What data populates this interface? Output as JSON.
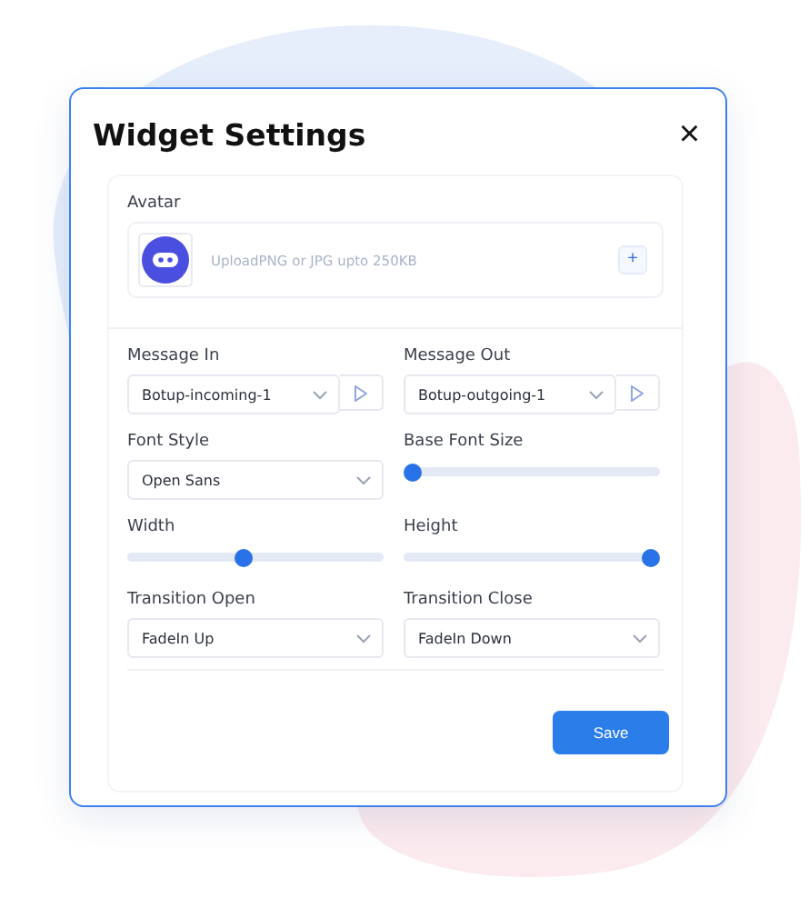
{
  "dialog": {
    "title": "Widget Settings",
    "close": "×"
  },
  "avatar": {
    "label": "Avatar",
    "hint": "UploadPNG or JPG upto 250KB",
    "add": "+"
  },
  "fields": [
    {
      "kind": "select-play",
      "label": "Message In",
      "value": "Botup-incoming-1"
    },
    {
      "kind": "select-play",
      "label": "Message Out",
      "value": "Botup-outgoing-1"
    },
    {
      "kind": "select",
      "label": "Font Style",
      "value": "Open Sans"
    },
    {
      "kind": "slider",
      "label": "Base Font Size",
      "level": 0
    },
    {
      "kind": "slider",
      "label": "Width",
      "level": 0.45
    },
    {
      "kind": "slider",
      "label": "Height",
      "level": 1
    },
    {
      "kind": "select",
      "label": "Transition Open",
      "value": "FadeIn Up"
    },
    {
      "kind": "select",
      "label": "Transition Close",
      "value": "FadeIn Down"
    }
  ],
  "buttons": [
    "Save"
  ]
}
